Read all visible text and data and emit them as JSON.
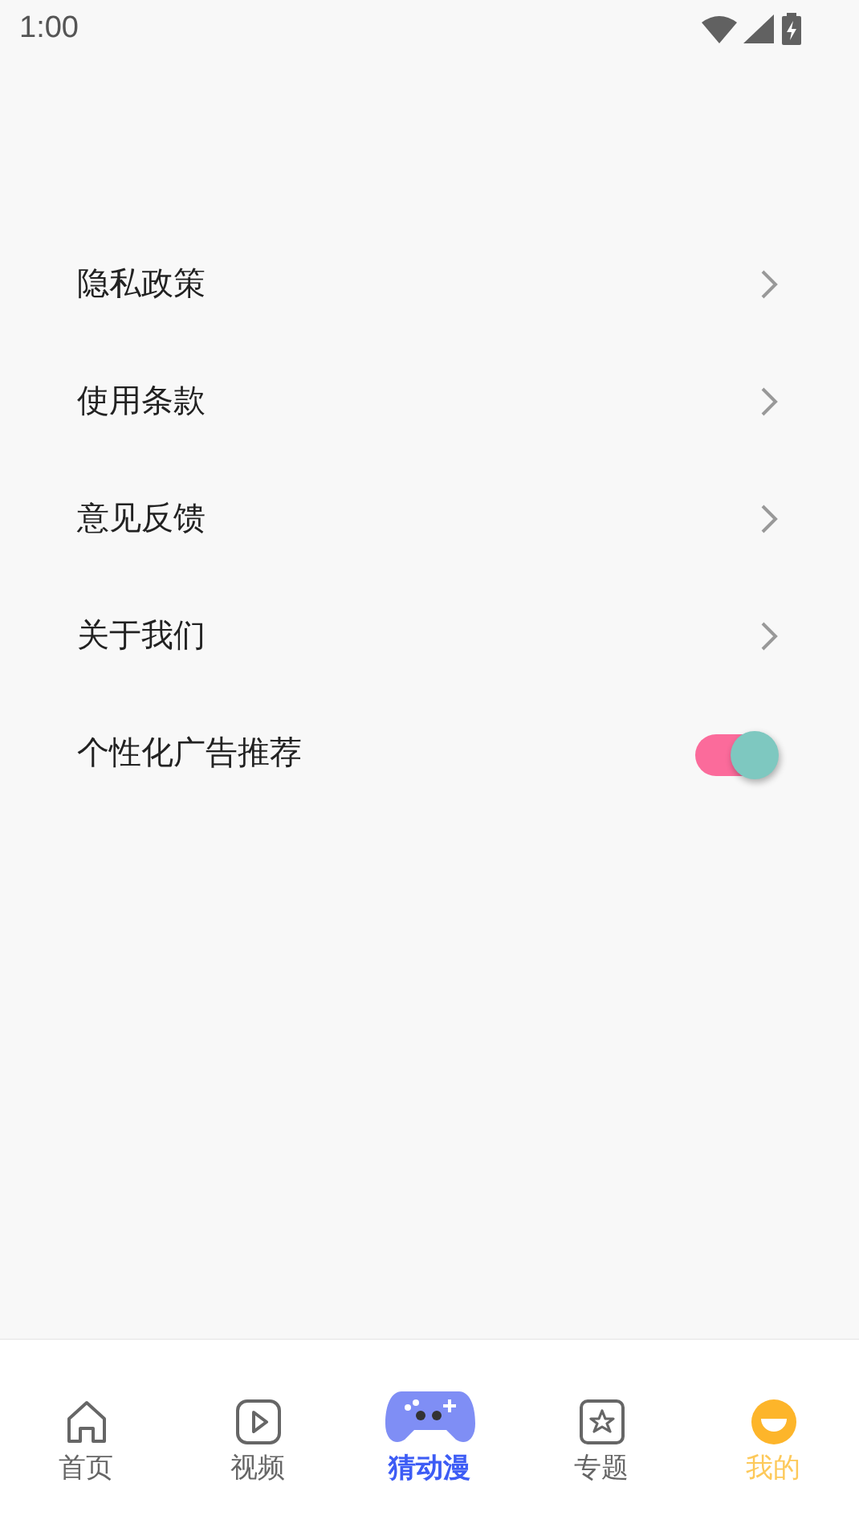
{
  "status_bar": {
    "time": "1:00"
  },
  "menu": [
    {
      "kind": "link",
      "label": "隐私政策"
    },
    {
      "kind": "link",
      "label": "使用条款"
    },
    {
      "kind": "link",
      "label": "意见反馈"
    },
    {
      "kind": "link",
      "label": "关于我们"
    },
    {
      "kind": "toggle",
      "label": "个性化广告推荐",
      "on": true
    }
  ],
  "tabs": [
    {
      "kind": "home",
      "label": "首页",
      "selected": false
    },
    {
      "kind": "video",
      "label": "视频",
      "selected": false
    },
    {
      "kind": "game",
      "label": "猜动漫",
      "selected": false
    },
    {
      "kind": "topic",
      "label": "专题",
      "selected": false
    },
    {
      "kind": "mine",
      "label": "我的",
      "selected": true
    }
  ]
}
